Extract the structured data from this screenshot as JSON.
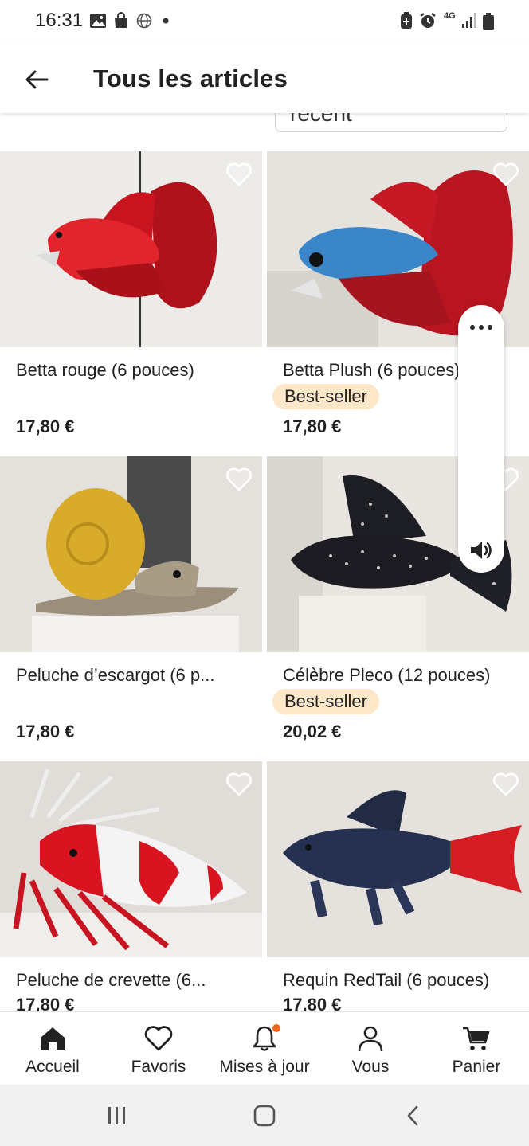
{
  "status_bar": {
    "time": "16:31",
    "network": "4G"
  },
  "header": {
    "title": "Tous les articles",
    "back_icon": "arrow-left-icon"
  },
  "sort": {
    "value_partial": "récent"
  },
  "products": [
    {
      "title": "Betta rouge (6 pouces)",
      "price": "17,80 €",
      "badge": "",
      "image": "red-betta-fish-plush"
    },
    {
      "title": "Betta Plush (6 pouces)",
      "price": "17,80 €",
      "badge": "Best-seller",
      "image": "blue-red-betta-fish-plush"
    },
    {
      "title": "Peluche d’escargot (6 p...",
      "price": "17,80 €",
      "badge": "",
      "image": "snail-plush"
    },
    {
      "title": "Célèbre Pleco (12 pouces)",
      "price": "20,02 €",
      "badge": "Best-seller",
      "image": "spotted-pleco-plush"
    },
    {
      "title": "Peluche de crevette (6...",
      "price": "17,80 €",
      "badge": "",
      "image": "shrimp-plush"
    },
    {
      "title": "Requin RedTail (6 pouces)",
      "price": "17,80 €",
      "badge": "",
      "image": "redtail-shark-plush"
    }
  ],
  "bottom_nav": [
    {
      "label": "Accueil",
      "icon": "home-icon",
      "active": true
    },
    {
      "label": "Favoris",
      "icon": "heart-icon",
      "active": false
    },
    {
      "label": "Mises à jour",
      "icon": "bell-icon",
      "active": false,
      "dot": true
    },
    {
      "label": "Vous",
      "icon": "user-icon",
      "active": false
    },
    {
      "label": "Panier",
      "icon": "cart-icon",
      "active": false
    }
  ],
  "colors": {
    "badge_bg": "#fde7c9",
    "notification_dot": "#f1641e",
    "text": "#222222"
  }
}
